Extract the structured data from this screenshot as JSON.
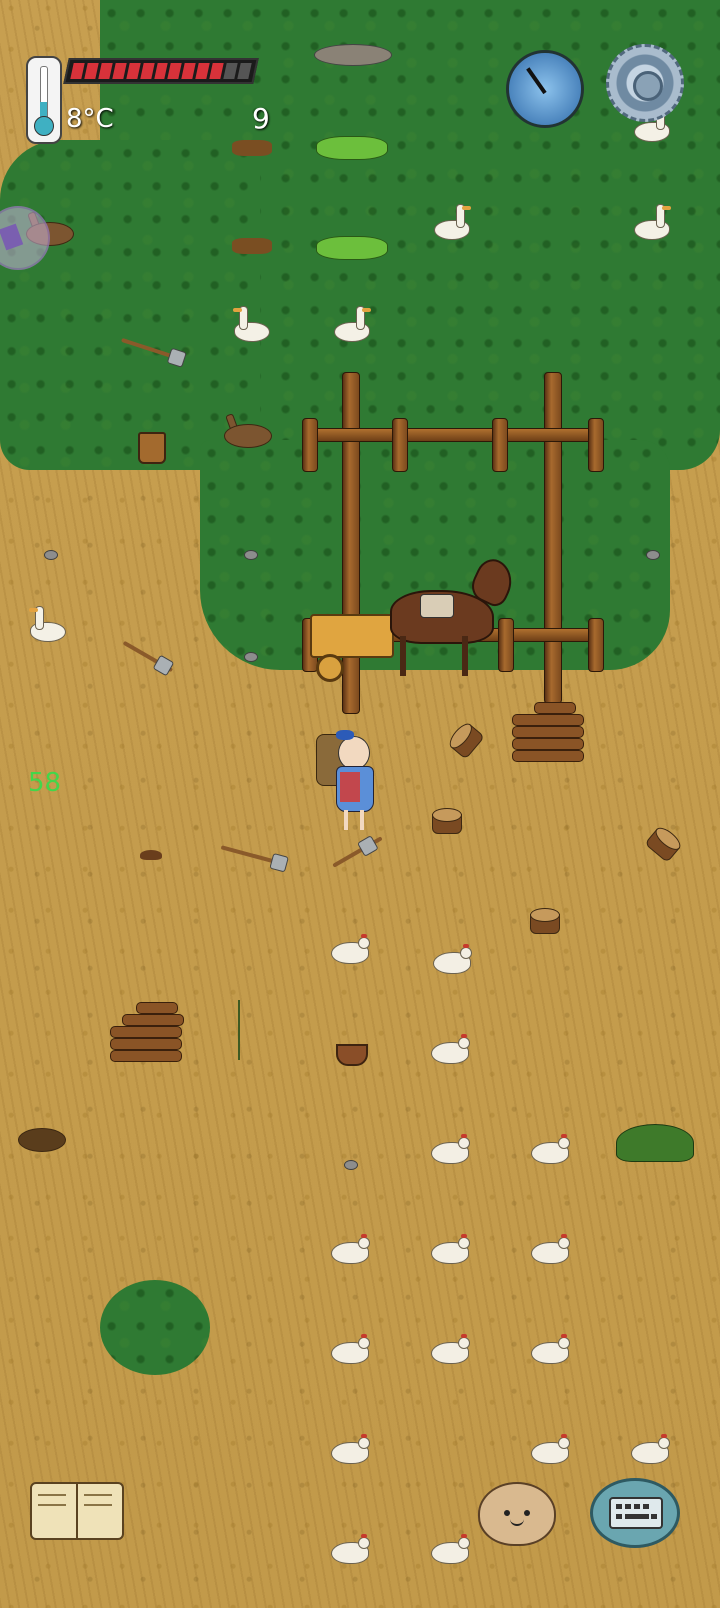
{
  "hud": {
    "temperature": "8°C",
    "age": "9",
    "fps": "58",
    "food_pips_total": 13,
    "food_pips_filled": 11,
    "thermometer_icon": "thermometer-icon",
    "compass_icon": "compass-icon",
    "settings_icon": "gear-icon",
    "recipe_book_icon": "book-icon",
    "emote_icon": "potato-face-icon",
    "chat_icon": "keyboard-speech-bubble-icon"
  },
  "colors": {
    "grass": "#2f7a33",
    "prairie": "#c79f50",
    "food_full": "#d8323a",
    "food_empty": "#555555",
    "fps_text": "#43d64a",
    "temperature_fill": "#3fb0c2"
  }
}
